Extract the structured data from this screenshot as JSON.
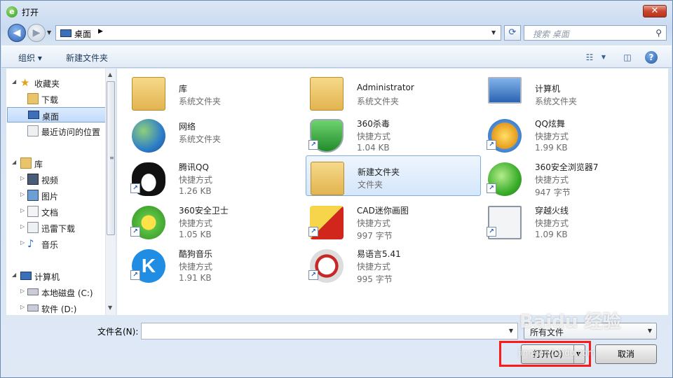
{
  "window": {
    "title": "打开",
    "icon": "e"
  },
  "address_bar": {
    "location": "桌面",
    "search_placeholder": "搜索 桌面"
  },
  "toolbar": {
    "organize": "组织 ▾",
    "new_folder": "新建文件夹"
  },
  "nav_pane": {
    "items": [
      {
        "label": "收藏夹",
        "icon": "star-icon"
      },
      {
        "label": "下载",
        "icon": "download-folder-icon"
      },
      {
        "label": "桌面",
        "icon": "desktop-icon",
        "selected": true
      },
      {
        "label": "最近访问的位置",
        "icon": "recent-places-icon"
      },
      {
        "label": "库",
        "icon": "libraries-icon"
      },
      {
        "label": "视频",
        "icon": "video-library-icon"
      },
      {
        "label": "图片",
        "icon": "pictures-library-icon"
      },
      {
        "label": "文档",
        "icon": "documents-library-icon"
      },
      {
        "label": "迅雷下载",
        "icon": "thunder-download-icon"
      },
      {
        "label": "音乐",
        "icon": "music-library-icon"
      },
      {
        "label": "计算机",
        "icon": "computer-icon"
      },
      {
        "label": "本地磁盘 (C:)",
        "icon": "local-disk-icon"
      },
      {
        "label": "软件 (D:)",
        "icon": "drive-icon"
      }
    ]
  },
  "files": [
    {
      "name": "库",
      "type": "系统文件夹",
      "size": "",
      "icon": "library-folder-icon"
    },
    {
      "name": "Administrator",
      "type": "系统文件夹",
      "size": "",
      "icon": "user-folder-icon"
    },
    {
      "name": "计算机",
      "type": "系统文件夹",
      "size": "",
      "icon": "computer-icon"
    },
    {
      "name": "网络",
      "type": "系统文件夹",
      "size": "",
      "icon": "network-icon"
    },
    {
      "name": "360杀毒",
      "type": "快捷方式",
      "size": "1.04 KB",
      "icon": "360-antivirus-icon"
    },
    {
      "name": "QQ炫舞",
      "type": "快捷方式",
      "size": "1.99 KB",
      "icon": "qq-dance-icon"
    },
    {
      "name": "腾讯QQ",
      "type": "快捷方式",
      "size": "1.26 KB",
      "icon": "qq-penguin-icon"
    },
    {
      "name": "新建文件夹",
      "type": "文件夹",
      "size": "",
      "icon": "folder-icon",
      "selected": true
    },
    {
      "name": "360安全浏览器7",
      "type": "快捷方式",
      "size": "947 字节",
      "icon": "360-browser-icon"
    },
    {
      "name": "360安全卫士",
      "type": "快捷方式",
      "size": "1.05 KB",
      "icon": "360-safeguard-icon"
    },
    {
      "name": "CAD迷你画图",
      "type": "快捷方式",
      "size": "997 字节",
      "icon": "cad-mini-icon"
    },
    {
      "name": "穿越火线",
      "type": "快捷方式",
      "size": "1.09 KB",
      "icon": "crossfire-icon"
    },
    {
      "name": "酷狗音乐",
      "type": "快捷方式",
      "size": "1.91 KB",
      "icon": "kugou-music-icon"
    },
    {
      "name": "易语言5.41",
      "type": "快捷方式",
      "size": "995 字节",
      "icon": "e-language-icon"
    }
  ],
  "bottom": {
    "filename_label": "文件名(N):",
    "filename_value": "",
    "filter_label": "所有文件",
    "open_label": "打开(O)",
    "cancel_label": "取消"
  },
  "watermark": {
    "text": "Baidu 经验",
    "url": "jingyan.baidu.com"
  }
}
